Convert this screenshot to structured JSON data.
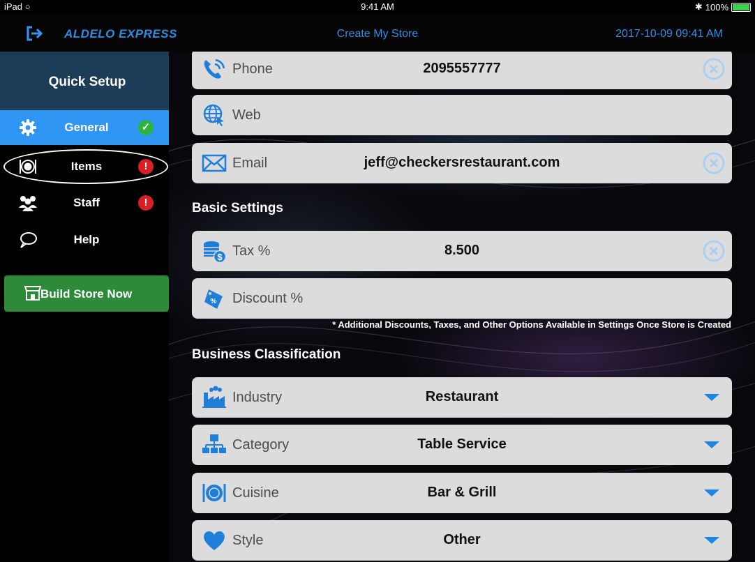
{
  "status_bar": {
    "device": "iPad",
    "time": "9:41 AM",
    "battery": "100%",
    "battery_level": 1.0
  },
  "header": {
    "brand": "ALDELO EXPRESS",
    "title": "Create My Store",
    "datetime": "2017-10-09 09:41 AM"
  },
  "sidebar": {
    "heading": "Quick Setup",
    "items": [
      {
        "label": "General",
        "icon": "gear-icon",
        "status": "complete"
      },
      {
        "label": "Items",
        "icon": "plate-icon",
        "status": "incomplete"
      },
      {
        "label": "Staff",
        "icon": "people-icon",
        "status": "incomplete"
      },
      {
        "label": "Help",
        "icon": "speech-bubble-icon",
        "status": "none"
      }
    ],
    "build_button": "Build Store Now"
  },
  "form": {
    "contact": [
      {
        "label": "Phone",
        "value": "2095557777",
        "icon": "phone-icon"
      },
      {
        "label": "Web",
        "value": "",
        "icon": "globe-icon"
      },
      {
        "label": "Email",
        "value": "jeff@checkersrestaurant.com",
        "icon": "envelope-icon"
      }
    ],
    "basic_settings_heading": "Basic Settings",
    "basic": [
      {
        "label": "Tax %",
        "value": "8.500",
        "icon": "coins-icon"
      },
      {
        "label": "Discount %",
        "value": "",
        "icon": "discount-tag-icon"
      }
    ],
    "note": "* Additional Discounts, Taxes, and Other Options Available in Settings Once Store is Created",
    "classification_heading": "Business Classification",
    "classification": [
      {
        "label": "Industry",
        "value": "Restaurant",
        "icon": "factory-icon"
      },
      {
        "label": "Category",
        "value": "Table Service",
        "icon": "hierarchy-icon"
      },
      {
        "label": "Cuisine",
        "value": "Bar & Grill",
        "icon": "plate-icon"
      },
      {
        "label": "Style",
        "value": "Other",
        "icon": "heart-icon"
      }
    ]
  },
  "colors": {
    "accent": "#2f96f4",
    "build": "#2c8a38",
    "ok": "#2cb33e",
    "warn": "#d91f26"
  }
}
